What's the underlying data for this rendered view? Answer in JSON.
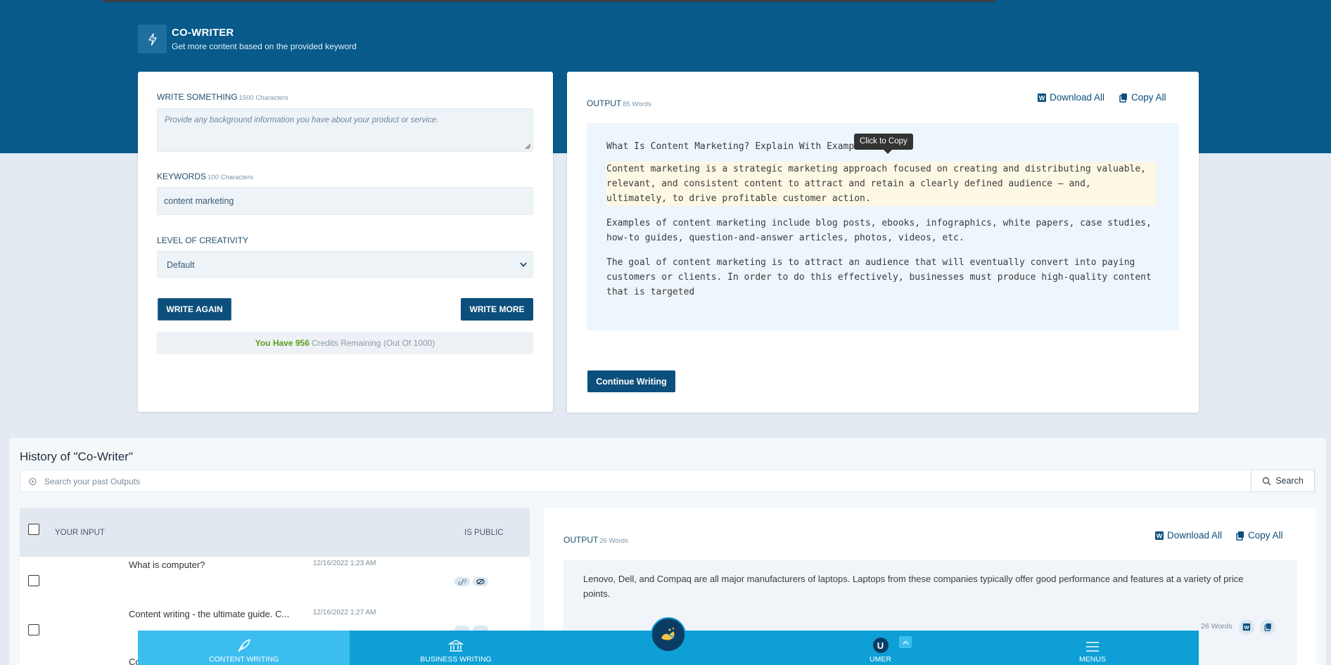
{
  "header": {
    "title": "CO-WRITER",
    "subtitle": "Get more content based on the provided keyword"
  },
  "form": {
    "write_label": "WRITE SOMETHING",
    "write_limit": "1500 Characters",
    "write_placeholder": "Provide any background information you have about your product or service.",
    "keywords_label": "KEYWORDS",
    "keywords_limit": "100 Characters",
    "keywords_value": "content marketing",
    "creativity_label": "LEVEL OF CREATIVITY",
    "creativity_value": "Default",
    "write_again_label": "WRITE AGAIN",
    "write_more_label": "WRITE MORE",
    "credits_prefix": "You Have 956",
    "credits_suffix": "Credits Remaining (Out Of 1000)"
  },
  "output": {
    "label": "OUTPUT",
    "word_count": "85 Words",
    "download_all": "Download All",
    "copy_all": "Copy All",
    "tooltip": "Click to Copy",
    "heading": "What Is Content Marketing? Explain With Examp",
    "paragraphs": [
      "Content marketing is a strategic marketing approach focused on creating and distributing valuable, relevant, and consistent content to attract and retain a clearly defined audience — and, ultimately, to drive profitable customer action.",
      "Examples of content marketing include blog posts, ebooks, infographics, white papers, case studies, how-to guides, question-and-answer articles, photos, videos, etc.",
      "The goal of content marketing is to attract an audience that will eventually convert into paying customers or clients. In order to do this effectively, businesses must produce high-quality content that is targeted"
    ],
    "continue_label": "Continue Writing"
  },
  "history": {
    "title": "History of \"Co-Writer\"",
    "search_placeholder": "Search your past Outputs",
    "search_button": "Search",
    "col_input": "YOUR INPUT",
    "col_public": "IS PUBLIC",
    "rows": [
      {
        "input": "What is computer?",
        "date": "12/16/2022 1:23 AM"
      },
      {
        "input": "Content writing - the ultimate guide. C...",
        "date": "12/16/2022 1:27 AM"
      },
      {
        "input": "Co",
        "date": ""
      }
    ],
    "output_label": "OUTPUT",
    "output_word_count": "26 Words",
    "download_all": "Download All",
    "copy_all": "Copy All",
    "output_text": "Lenovo, Dell, and Compaq are all major manufacturers of laptops. Laptops from these companies typically offer good performance and features at a variety of price points.",
    "footer_words": "26 Words"
  },
  "bottom_nav": {
    "content_writing": "CONTENT WRITING",
    "business_writing": "BUSINESS WRITING",
    "user_initial": "U",
    "user_name": "UMER",
    "menus": "MENUS"
  },
  "colors": {
    "hero": "#075a8a",
    "primary_button": "#0c4f7c",
    "nav": "#0e9fd6",
    "nav_active": "#3cbdf0",
    "credits_green": "#5d9c1c"
  }
}
